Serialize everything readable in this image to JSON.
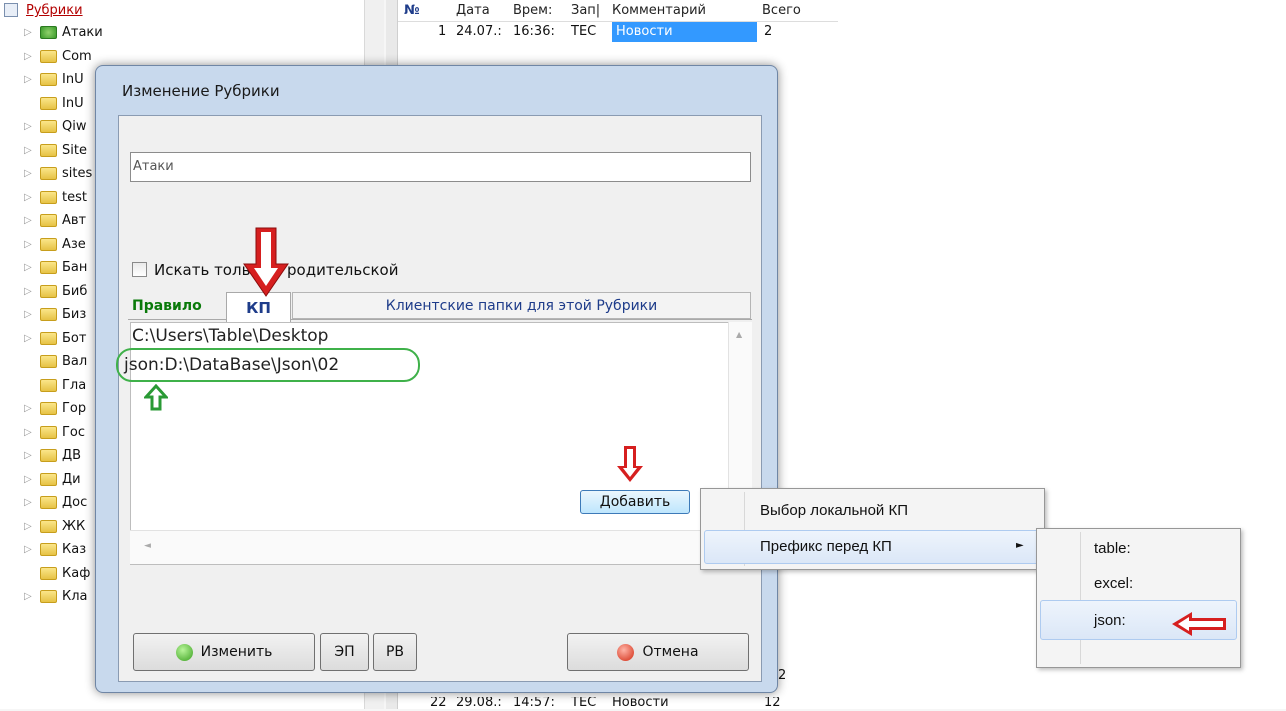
{
  "tree": {
    "root_label": "Рубрики",
    "items": [
      "Атаки",
      "Com",
      "InU",
      "InU",
      "Qiw",
      "Site",
      "sites",
      "test",
      "Авт",
      "Азе",
      "Бан",
      "Биб",
      "Биз",
      "Бот",
      "Вал",
      "Гла",
      "Гор",
      "Гос",
      "ДВ",
      "Ди",
      "Дос",
      "ЖК",
      "Каз",
      "Каф",
      "Кла"
    ]
  },
  "grid": {
    "headers": [
      "№",
      "Дата",
      "Врем:",
      "Зап|",
      "Комментарий",
      "Всего"
    ],
    "row1": {
      "num": "1",
      "date": "24.07.:",
      "time": "16:36:",
      "code": "TEC",
      "comment": "Новости",
      "total": "2"
    },
    "row_bottom": {
      "num": "22",
      "date": "29.08.:",
      "time": "14:57:",
      "code": "TEC",
      "comment": "Новости",
      "total": "12"
    },
    "partial_total": "2"
  },
  "dialog": {
    "title": "Изменение Рубрики",
    "name_value": "Атаки",
    "checkbox_label": "Искать только в родительской",
    "tab_rule": "Правило",
    "tab_kp": "КП",
    "tab_client": "Клиентские папки для этой Рубрики",
    "paths": [
      "C:\\Users\\Table\\Desktop",
      "json:D:\\DataBase\\Json\\02"
    ],
    "add_label": "Добавить",
    "change_label": "Изменить",
    "ep_label": "ЭП",
    "rv_label": "РВ",
    "cancel_label": "Отмена"
  },
  "menu1": {
    "items": [
      "Выбор локальной КП",
      "Префикс перед КП"
    ]
  },
  "menu2": {
    "items": [
      "table:",
      "excel:",
      "json:"
    ]
  },
  "colors": {
    "accent_red": "#d61f1f",
    "green": "#3fb14a",
    "highlight": "#3399ff"
  }
}
